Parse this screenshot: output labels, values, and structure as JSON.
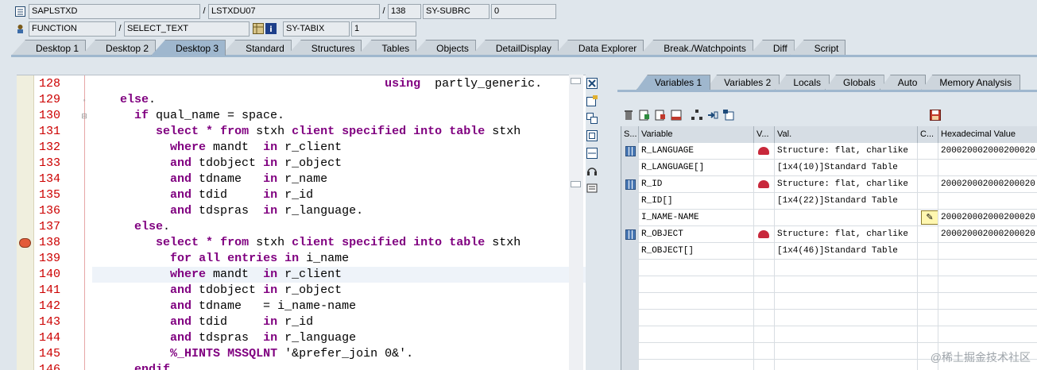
{
  "header": {
    "row1": {
      "program": "SAPLSTXD",
      "include": "LSTXDU07",
      "line": "138",
      "sysfield": "SY-SUBRC",
      "sysvalue": "0"
    },
    "row2": {
      "evtype": "FUNCTION",
      "event": "SELECT_TEXT",
      "sysfield": "SY-TABIX",
      "sysvalue": "1"
    },
    "separator": "/"
  },
  "main_tabs": [
    "Desktop 1",
    "Desktop 2",
    "Desktop 3",
    "Standard",
    "Structures",
    "Tables",
    "Objects",
    "DetailDisplay",
    "Data Explorer",
    "Break./Watchpoints",
    "Diff",
    "Script"
  ],
  "main_tabs_active": 2,
  "code": {
    "lines": [
      {
        "num": "128",
        "text": "                                         using  partly_generic."
      },
      {
        "num": "129",
        "text": "    else."
      },
      {
        "num": "130",
        "text": "      if qual_name = space."
      },
      {
        "num": "131",
        "text": "         select * from stxh client specified into table stxh"
      },
      {
        "num": "132",
        "text": "           where mandt  in r_client"
      },
      {
        "num": "133",
        "text": "           and tdobject in r_object"
      },
      {
        "num": "134",
        "text": "           and tdname   in r_name"
      },
      {
        "num": "135",
        "text": "           and tdid     in r_id"
      },
      {
        "num": "136",
        "text": "           and tdspras  in r_language."
      },
      {
        "num": "137",
        "text": "      else."
      },
      {
        "num": "138",
        "text": "         select * from stxh client specified into table stxh"
      },
      {
        "num": "139",
        "text": "           for all entries in i_name"
      },
      {
        "num": "140",
        "text": "           where mandt  in r_client"
      },
      {
        "num": "141",
        "text": "           and tdobject in r_object"
      },
      {
        "num": "142",
        "text": "           and tdname   = i_name-name"
      },
      {
        "num": "143",
        "text": "           and tdid     in r_id"
      },
      {
        "num": "144",
        "text": "           and tdspras  in r_language"
      },
      {
        "num": "145",
        "text": "           %_HINTS MSSQLNT '&prefer_join 0&'."
      },
      {
        "num": "146",
        "text": "      endif."
      }
    ],
    "highlight_line": "140",
    "breakpoint_line": "138"
  },
  "var_tabs": [
    "Variables 1",
    "Variables 2",
    "Locals",
    "Globals",
    "Auto",
    "Memory Analysis"
  ],
  "var_tabs_active": 0,
  "grid": {
    "headers": [
      "S...",
      "Variable",
      "V...",
      "Val.",
      "C...",
      "Hexadecimal Value"
    ],
    "rows": [
      {
        "icon": "structure-icon",
        "variable": "R_LANGUAGE",
        "vicon": "hat-icon",
        "value": "Structure: flat, charlike",
        "change": "",
        "hex": "200020002000200020"
      },
      {
        "icon": "",
        "variable": "R_LANGUAGE[]",
        "vicon": "",
        "value": "[1x4(10)]Standard Table",
        "change": "",
        "hex": ""
      },
      {
        "icon": "structure-icon",
        "variable": "R_ID",
        "vicon": "hat-icon",
        "value": "Structure: flat, charlike",
        "change": "",
        "hex": "200020002000200020"
      },
      {
        "icon": "",
        "variable": "R_ID[]",
        "vicon": "",
        "value": "[1x4(22)]Standard Table",
        "change": "",
        "hex": ""
      },
      {
        "icon": "",
        "variable": "I_NAME-NAME",
        "vicon": "",
        "value": "",
        "change": "pencil-icon",
        "hex": "200020002000200020"
      },
      {
        "icon": "structure-icon",
        "variable": "R_OBJECT",
        "vicon": "hat-icon",
        "value": "Structure: flat, charlike",
        "change": "",
        "hex": "200020002000200020"
      },
      {
        "icon": "",
        "variable": "R_OBJECT[]",
        "vicon": "",
        "value": "[1x4(46)]Standard Table",
        "change": "",
        "hex": ""
      }
    ],
    "empty_rows": 7
  },
  "watermark": "@稀土掘金技术社区"
}
